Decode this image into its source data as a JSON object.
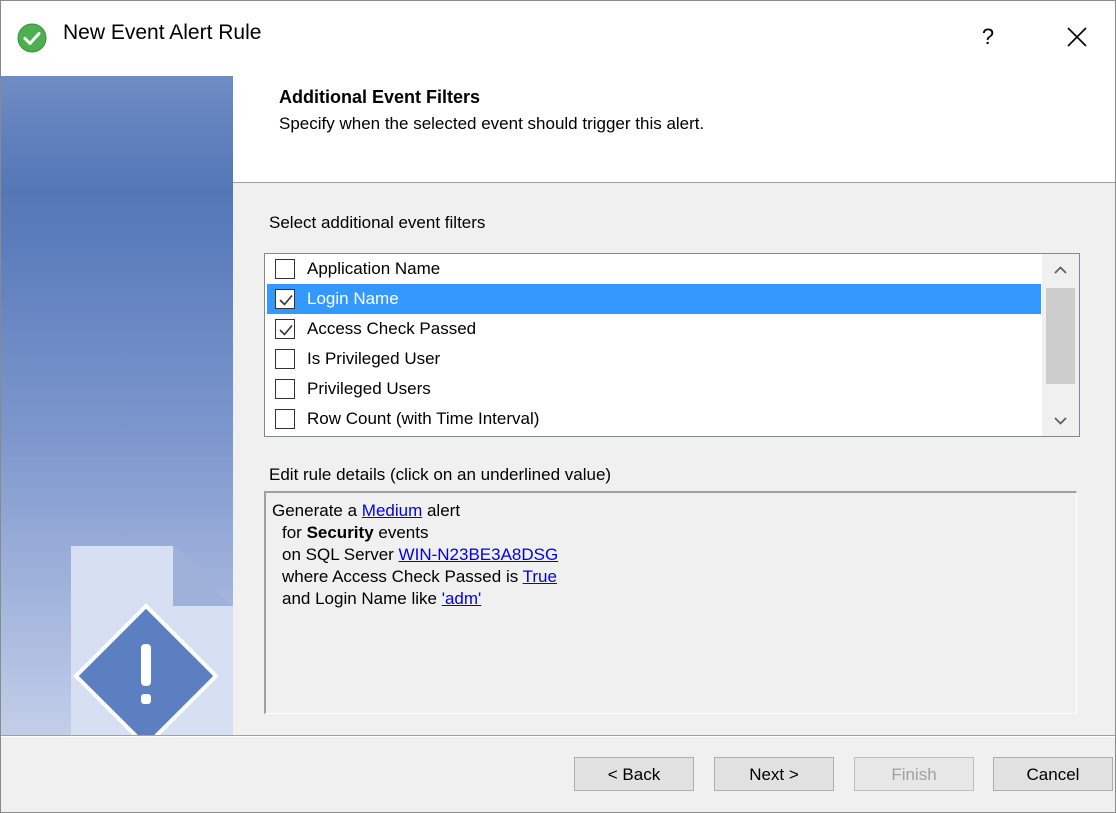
{
  "window": {
    "title": "New Event Alert Rule",
    "help_label": "?"
  },
  "header": {
    "title": "Additional Event Filters",
    "subtitle": "Specify when the selected event should trigger this alert."
  },
  "filters": {
    "label": "Select additional event filters",
    "items": [
      {
        "label": "Application Name",
        "checked": false,
        "selected": false
      },
      {
        "label": "Login Name",
        "checked": true,
        "selected": true
      },
      {
        "label": "Access Check Passed",
        "checked": true,
        "selected": false
      },
      {
        "label": "Is Privileged User",
        "checked": false,
        "selected": false
      },
      {
        "label": "Privileged Users",
        "checked": false,
        "selected": false
      },
      {
        "label": "Row Count (with Time Interval)",
        "checked": false,
        "selected": false
      }
    ]
  },
  "rule_details": {
    "label": "Edit rule details (click on an underlined value)",
    "line1": {
      "prefix": "Generate a ",
      "link": "Medium",
      "suffix": " alert"
    },
    "line2": {
      "prefix": "for ",
      "bold": "Security",
      "suffix": " events"
    },
    "line3": {
      "prefix": "on SQL Server ",
      "link": "WIN-N23BE3A8DSG"
    },
    "line4": {
      "prefix": "where Access Check Passed is ",
      "link": "True"
    },
    "line5": {
      "prefix": "and Login Name like ",
      "link": "'adm'"
    }
  },
  "buttons": {
    "back": "< Back",
    "next": "Next >",
    "finish": "Finish",
    "cancel": "Cancel"
  },
  "colors": {
    "selection": "#3399ff",
    "link": "#0000ee",
    "title_icon": "#4caf50",
    "banner_art": "#5b7fc0"
  },
  "icons": {
    "title": "green-check-circle-icon",
    "help": "help-icon",
    "close": "close-icon",
    "banner": "warning-document-icon",
    "scroll_up": "chevron-up-icon",
    "scroll_down": "chevron-down-icon"
  }
}
